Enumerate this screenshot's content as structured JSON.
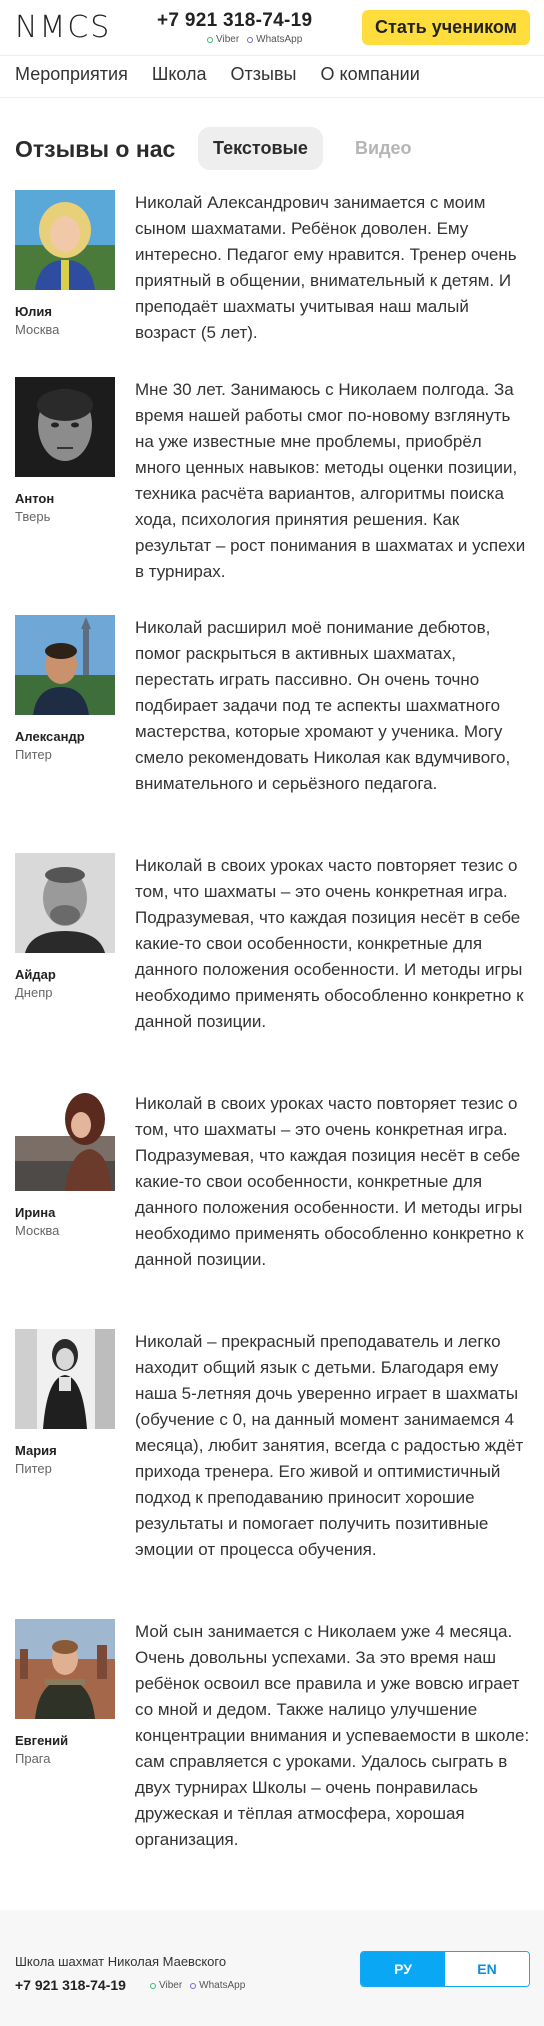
{
  "header": {
    "logo": "NMCS",
    "phone": "+7 921 318-74-19",
    "viber": "Viber",
    "whatsapp": "WhatsApp",
    "cta": "Стать учеником"
  },
  "nav": [
    "Мероприятия",
    "Школа",
    "Отзывы",
    "О компании"
  ],
  "section": {
    "title": "Отзывы о нас",
    "tab_text": "Текстовые",
    "tab_video": "Видео"
  },
  "reviews": [
    {
      "name": "Юлия",
      "city": "Москва",
      "text": "Николай Александрович занимается с моим сыном шахматами. Ребёнок доволен. Ему интересно. Педагог ему нравится. Тренер очень приятный в общении, внимательный к детям. И преподаёт шахматы учитывая наш малый возраст (5 лет)."
    },
    {
      "name": "Антон",
      "city": "Тверь",
      "text": "Мне 30 лет. Занимаюсь с Николаем полгода. За время нашей работы смог по-новому взглянуть на уже известные мне проблемы, приобрёл много ценных навыков: методы оценки позиции, техника расчёта вариантов, алгоритмы поиска хода, психология принятия решения. Как результат – рост понимания в шахматах и успехи в турнирах."
    },
    {
      "name": "Александр",
      "city": "Питер",
      "text": "Николай расширил моё понимание дебютов, помог раскрыться в активных шахматах, перестать играть пассивно. Он очень точно подбирает задачи под те аспекты шахматного мастерства, которые хромают у ученика. Могу смело рекомендовать Николая как вдумчивого, внимательного и серьёзного педагога."
    },
    {
      "name": "Айдар",
      "city": "Днепр",
      "text": "Николай в своих уроках часто повторяет тезис о том, что шахматы – это очень конкретная игра. Подразумевая, что каждая позиция несёт в себе какие-то свои особенности, конкретные для данного положения особенности. И методы игры необходимо применять обособленно конкретно к данной позиции."
    },
    {
      "name": "Ирина",
      "city": "Москва",
      "text": "Николай в своих уроках часто повторяет тезис о том, что шахматы – это очень конкретная игра. Подразумевая, что каждая позиция несёт в себе какие-то свои особенности, конкретные для данного положения особенности. И методы игры необходимо применять обособленно конкретно к данной позиции."
    },
    {
      "name": "Мария",
      "city": "Питер",
      "text": "Николай – прекрасный преподаватель и легко находит общий язык с детьми. Благодаря ему наша 5-летняя дочь уверенно играет в шахматы (обучение с 0, на данный момент занимаемся 4 месяца), любит занятия, всегда с радостью ждёт прихода тренера. Его живой и оптимистичный подход к преподаванию приносит хорошие результаты и помогает получить позитивные эмоции от процесса обучения."
    },
    {
      "name": "Евгений",
      "city": "Прага",
      "text": "Мой сын занимается с Николаем уже 4 месяца. Очень довольны успехами. За это время наш ребёнок освоил все правила и уже вовсю играет со мной и дедом. Также налицо улучшение концентрации внимания и успеваемости в школе: сам справляется с уроками. Удалось сыграть в двух турнирах Школы – очень понравилась дружеская и тёплая атмосфера, хорошая организация."
    }
  ],
  "footer": {
    "school": "Школа шахмат Николая Маевского",
    "phone": "+7 921 318-74-19",
    "viber": "Viber",
    "whatsapp": "WhatsApp",
    "lang_ru": "РУ",
    "lang_en": "EN"
  }
}
